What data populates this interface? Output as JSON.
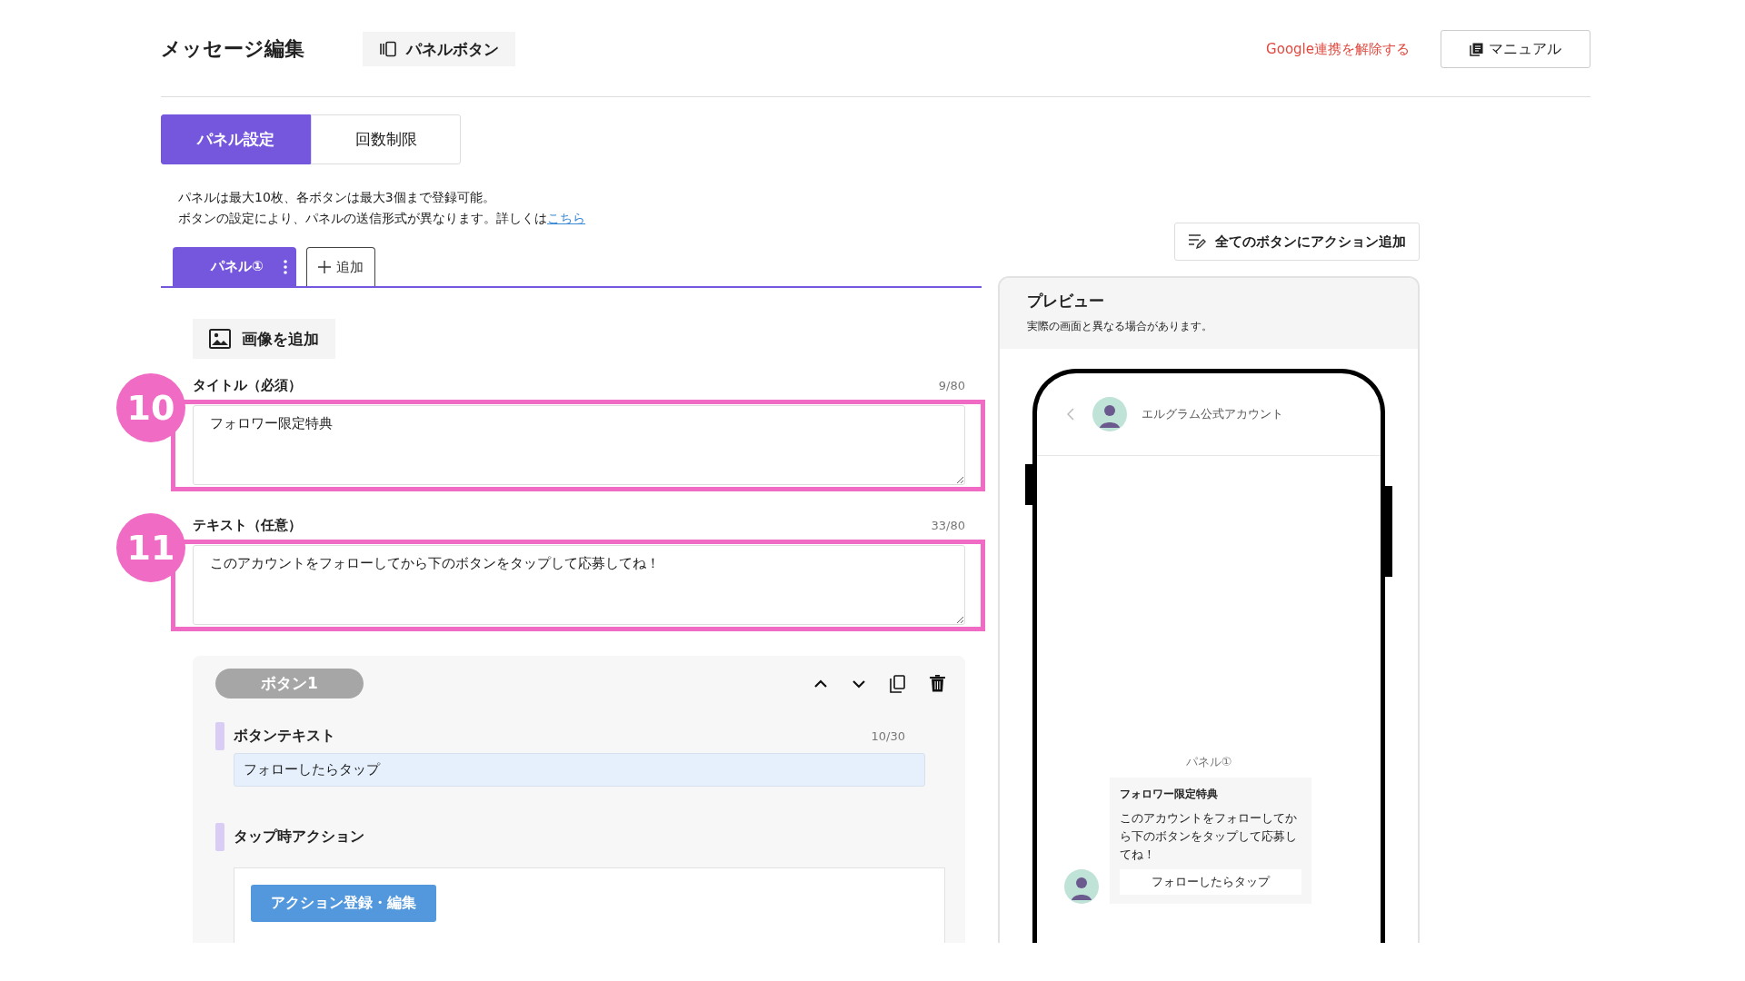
{
  "header": {
    "title": "メッセージ編集",
    "panel_button": "パネルボタン",
    "google_link": "Google連携を解除する",
    "manual_button": "マニュアル"
  },
  "tabs": [
    {
      "label": "パネル設定",
      "selected": true
    },
    {
      "label": "回数制限",
      "selected": false
    }
  ],
  "notes": {
    "line1": "パネルは最大10枚、各ボタンは最大3個まで登録可能。",
    "line2": "ボタンの設定により、パネルの送信形式が異なります。詳しくは",
    "link": "こちら"
  },
  "panel_tabs": [
    {
      "label": "パネル①",
      "selected": true
    }
  ],
  "add_panel_button": "追加",
  "add_image_button": "画像を追加",
  "fields": [
    {
      "label": "タイトル（必須）",
      "count": "9/80",
      "value": "フォロワー限定特典",
      "annotation": "10"
    },
    {
      "label": "テキスト（任意）",
      "count": "33/80",
      "value": "このアカウントをフォローしてから下のボタンをタップして応募してね！",
      "annotation": "11"
    }
  ],
  "button_card": {
    "pill": "ボタン1",
    "text_label": "ボタンテキスト",
    "text_count": "10/30",
    "text_value": "フォローしたらタップ",
    "action_label": "タップ時アクション",
    "action_button": "アクション登録・編集"
  },
  "add_action_all_button": "全てのボタンにアクション追加",
  "preview": {
    "title": "プレビュー",
    "note": "実際の画面と異なる場合があります。",
    "account_name": "エルグラム公式アカウント",
    "panel_label": "パネル①",
    "card_title": "フォロワー限定特典",
    "card_text": "このアカウントをフォローしてから下のボタンをタップして応募してね！",
    "card_button": "フォローしたらタップ"
  }
}
